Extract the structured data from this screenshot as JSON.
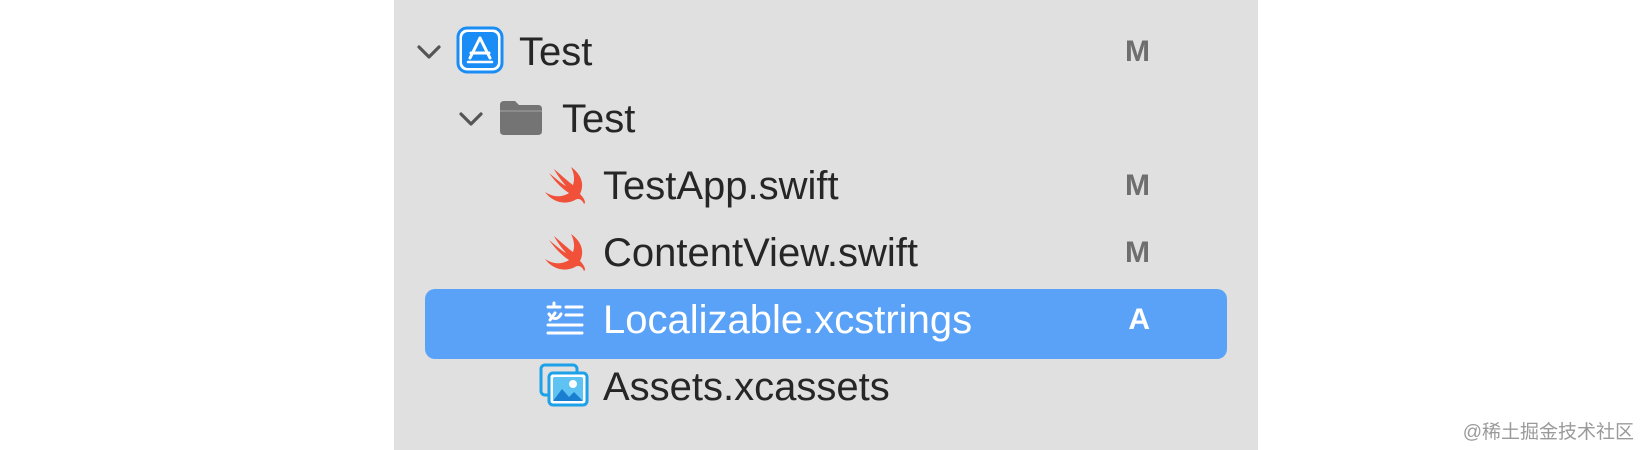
{
  "navigator": {
    "items": [
      {
        "name": "Test",
        "status": "M",
        "icon": "app-project-icon",
        "expanded": true
      },
      {
        "name": "Test",
        "status": "",
        "icon": "folder-icon",
        "expanded": true
      },
      {
        "name": "TestApp.swift",
        "status": "M",
        "icon": "swift-file-icon"
      },
      {
        "name": "ContentView.swift",
        "status": "M",
        "icon": "swift-file-icon"
      },
      {
        "name": "Localizable.xcstrings",
        "status": "A",
        "icon": "string-catalog-icon",
        "selected": true
      },
      {
        "name": "Assets.xcassets",
        "status": "",
        "icon": "asset-catalog-icon"
      }
    ]
  },
  "colors": {
    "sidebar_background": "#e0e0e0",
    "selection": "#5aa2f8",
    "swift_orange": "#f05138",
    "app_blue": "#1a8cf5"
  },
  "watermark": "@稀土掘金技术社区"
}
